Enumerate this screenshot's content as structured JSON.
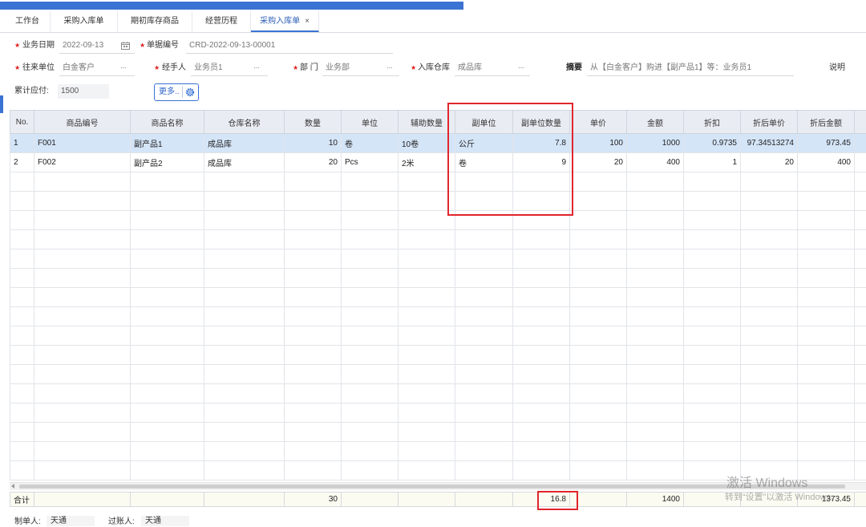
{
  "tabs": [
    {
      "label": "工作台"
    },
    {
      "label": "采购入库单"
    },
    {
      "label": "期初库存商品"
    },
    {
      "label": "经营历程"
    },
    {
      "label": "采购入库单",
      "active": true
    }
  ],
  "tab_close": "×",
  "required_mark": "★",
  "lookup_button": "···",
  "form": {
    "business_date": {
      "label": "业务日期",
      "value": "2022-09-13",
      "icon": "calendar-icon"
    },
    "doc_no": {
      "label": "单据编号",
      "value": "CRD-2022-09-13-00001"
    },
    "partner": {
      "label": "往来单位",
      "value": "白金客户"
    },
    "handler": {
      "label": "经手人",
      "value": "业务员1"
    },
    "department": {
      "label": "部 门",
      "value": "业务部"
    },
    "warehouse": {
      "label": "入库仓库",
      "value": "成品库"
    },
    "summary": {
      "label": "摘要",
      "value": "从【白金客户】购进【副产品1】等：业务员1"
    },
    "remark": {
      "label": "说明"
    },
    "payable": {
      "label": "累计应付:",
      "value": "1500"
    },
    "more_button": {
      "label": "更多..",
      "icon": "gear-icon"
    }
  },
  "table": {
    "columns": [
      "No.",
      "商品编号",
      "商品名称",
      "仓库名称",
      "数量",
      "单位",
      "辅助数量",
      "副单位",
      "副单位数量",
      "单价",
      "金额",
      "折扣",
      "折后单价",
      "折后金额"
    ],
    "rows": [
      {
        "no": "1",
        "code": "F001",
        "name": "副产品1",
        "warehouse": "成品库",
        "qty": "10",
        "unit": "卷",
        "aux_qty": "10卷",
        "sub_unit": "公斤",
        "sub_qty": "7.8",
        "price": "100",
        "amount": "1000",
        "discount": "0.9735",
        "disc_price": "97.34513274",
        "disc_amount": "973.45",
        "selected": true
      },
      {
        "no": "2",
        "code": "F002",
        "name": "副产品2",
        "warehouse": "成品库",
        "qty": "20",
        "unit": "Pcs",
        "aux_qty": "2米",
        "sub_unit": "卷",
        "sub_qty": "9",
        "price": "20",
        "amount": "400",
        "discount": "1",
        "disc_price": "20",
        "disc_amount": "400",
        "selected": false
      }
    ],
    "totals": {
      "label": "合计",
      "qty": "30",
      "sub_qty": "16.8",
      "amount": "1400",
      "disc_amount": "1373.45"
    }
  },
  "footer": {
    "creator_label": "制单人:",
    "creator": "天通",
    "poster_label": "过账人:",
    "poster": "天通"
  },
  "watermark": {
    "title": "激活 Windows",
    "hint": "转到“设置”以激活 Windows。"
  },
  "colors": {
    "accent": "#3b73d4",
    "highlight": "#e0262d",
    "selected_row": "#d5e5f8",
    "required": "#e02020"
  }
}
